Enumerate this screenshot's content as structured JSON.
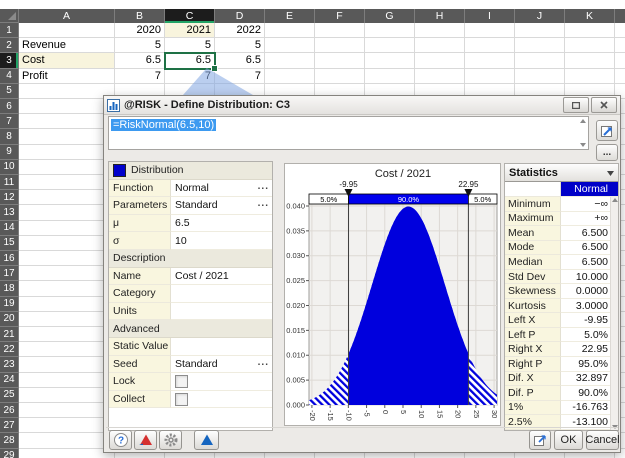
{
  "spreadsheet": {
    "columns": [
      "A",
      "B",
      "C",
      "D",
      "E",
      "F",
      "G",
      "H",
      "I",
      "J",
      "K"
    ],
    "row_count": 28,
    "selected_column": "C",
    "selected_row": 3,
    "selected_cell": "C3",
    "cells": [
      {
        "ref": "B1",
        "text": "2020"
      },
      {
        "ref": "C1",
        "text": "2021",
        "highlight": true
      },
      {
        "ref": "D1",
        "text": "2022"
      },
      {
        "ref": "A2",
        "text": "Revenue",
        "align": "left"
      },
      {
        "ref": "B2",
        "text": "5"
      },
      {
        "ref": "C2",
        "text": "5"
      },
      {
        "ref": "D2",
        "text": "5"
      },
      {
        "ref": "A3",
        "text": "Cost",
        "align": "left",
        "highlight": true
      },
      {
        "ref": "B3",
        "text": "6.5"
      },
      {
        "ref": "C3",
        "text": "6.5"
      },
      {
        "ref": "D3",
        "text": "6.5"
      },
      {
        "ref": "A4",
        "text": "Profit",
        "align": "left"
      },
      {
        "ref": "B4",
        "text": "7"
      },
      {
        "ref": "C4",
        "text": "7"
      },
      {
        "ref": "D4",
        "text": "7"
      }
    ]
  },
  "dialog": {
    "title": "@RISK - Define Distribution: C3",
    "formula": "=RiskNormal(6.5,10)",
    "more_label": "...",
    "help_glyph": "?",
    "property_grid": {
      "rows": [
        {
          "type": "section",
          "label": "Distribution",
          "swatch": true
        },
        {
          "type": "row",
          "label": "Function",
          "value": "Normal",
          "ellipsis": true
        },
        {
          "type": "row",
          "label": "Parameters",
          "value": "Standard",
          "ellipsis": true
        },
        {
          "type": "row",
          "label": "μ",
          "value": "6.5"
        },
        {
          "type": "row",
          "label": "σ",
          "value": "10"
        },
        {
          "type": "section",
          "label": "Description"
        },
        {
          "type": "row",
          "label": "Name",
          "value": "Cost / 2021"
        },
        {
          "type": "row",
          "label": "Category",
          "value": ""
        },
        {
          "type": "row",
          "label": "Units",
          "value": ""
        },
        {
          "type": "section",
          "label": "Advanced"
        },
        {
          "type": "row",
          "label": "Static Value",
          "value": ""
        },
        {
          "type": "row",
          "label": "Seed",
          "value": "Standard",
          "ellipsis": true
        },
        {
          "type": "row",
          "label": "Lock",
          "checkbox": true
        },
        {
          "type": "row",
          "label": "Collect",
          "checkbox": true
        }
      ]
    },
    "statistics": {
      "header": "Statistics",
      "column_header": "Normal",
      "rows": [
        {
          "label": "Minimum",
          "value": "−∞"
        },
        {
          "label": "Maximum",
          "value": "+∞"
        },
        {
          "label": "Mean",
          "value": "6.500"
        },
        {
          "label": "Mode",
          "value": "6.500"
        },
        {
          "label": "Median",
          "value": "6.500"
        },
        {
          "label": "Std Dev",
          "value": "10.000"
        },
        {
          "label": "Skewness",
          "value": "0.0000"
        },
        {
          "label": "Kurtosis",
          "value": "3.0000"
        },
        {
          "label": "Left X",
          "value": "-9.95"
        },
        {
          "label": "Left P",
          "value": "5.0%"
        },
        {
          "label": "Right X",
          "value": "22.95"
        },
        {
          "label": "Right P",
          "value": "95.0%"
        },
        {
          "label": "Dif. X",
          "value": "32.897"
        },
        {
          "label": "Dif. P",
          "value": "90.0%"
        },
        {
          "label": "1%",
          "value": "-16.763"
        },
        {
          "label": "2.5%",
          "value": "-13.100"
        }
      ]
    },
    "footer": {
      "ok": "OK",
      "cancel": "Cancel"
    }
  },
  "chart_data": {
    "type": "area",
    "title": "Cost / 2021",
    "distribution": "normal",
    "mu": 6.5,
    "sigma": 10,
    "xlim": [
      -20.8,
      30.8
    ],
    "ylim": [
      0,
      0.0404
    ],
    "x_ticks": [
      -20,
      -15,
      -10,
      -5,
      0,
      5,
      10,
      15,
      20,
      25,
      30
    ],
    "y_ticks": [
      0,
      0.005,
      0.01,
      0.015,
      0.02,
      0.025,
      0.03,
      0.035,
      0.04
    ],
    "delimiters": {
      "left_x": -9.95,
      "right_x": 22.95,
      "left_label": "-9.95",
      "right_label": "22.95",
      "left_p": "5.0%",
      "center_p": "90.0%",
      "right_p": "5.0%"
    },
    "colors": {
      "fill": "#0000dd",
      "band": "#0000ee",
      "plot_bg": "#f2f1ef"
    }
  }
}
